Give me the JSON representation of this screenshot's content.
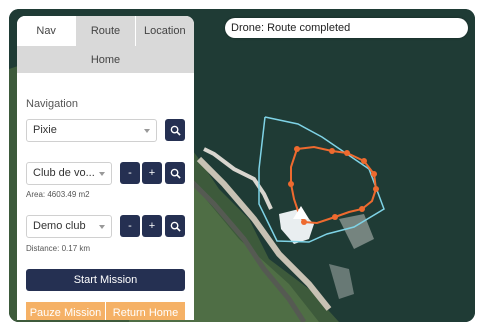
{
  "status": {
    "text": "Drone: Route completed"
  },
  "tabs": [
    {
      "label": "Nav"
    },
    {
      "label": "Route"
    },
    {
      "label": "Location"
    }
  ],
  "home": {
    "label": "Home"
  },
  "navigation": {
    "section_label": "Navigation",
    "drone_select": "Pixie",
    "club_select": "Club de vo...",
    "area_text": "Area: 4603.49 m2",
    "route_select": "Demo club",
    "distance_text": "Distance: 0.17 km",
    "minus_label": "-",
    "plus_label": "+"
  },
  "actions": {
    "start_mission": "Start Mission",
    "pause_mission": "Pauze Mission",
    "return_home": "Return Home"
  },
  "colors": {
    "route": "#ee6a2f",
    "geofence": "#7fd3e6",
    "button_dark": "#253052",
    "button_orange": "#f5b166"
  }
}
